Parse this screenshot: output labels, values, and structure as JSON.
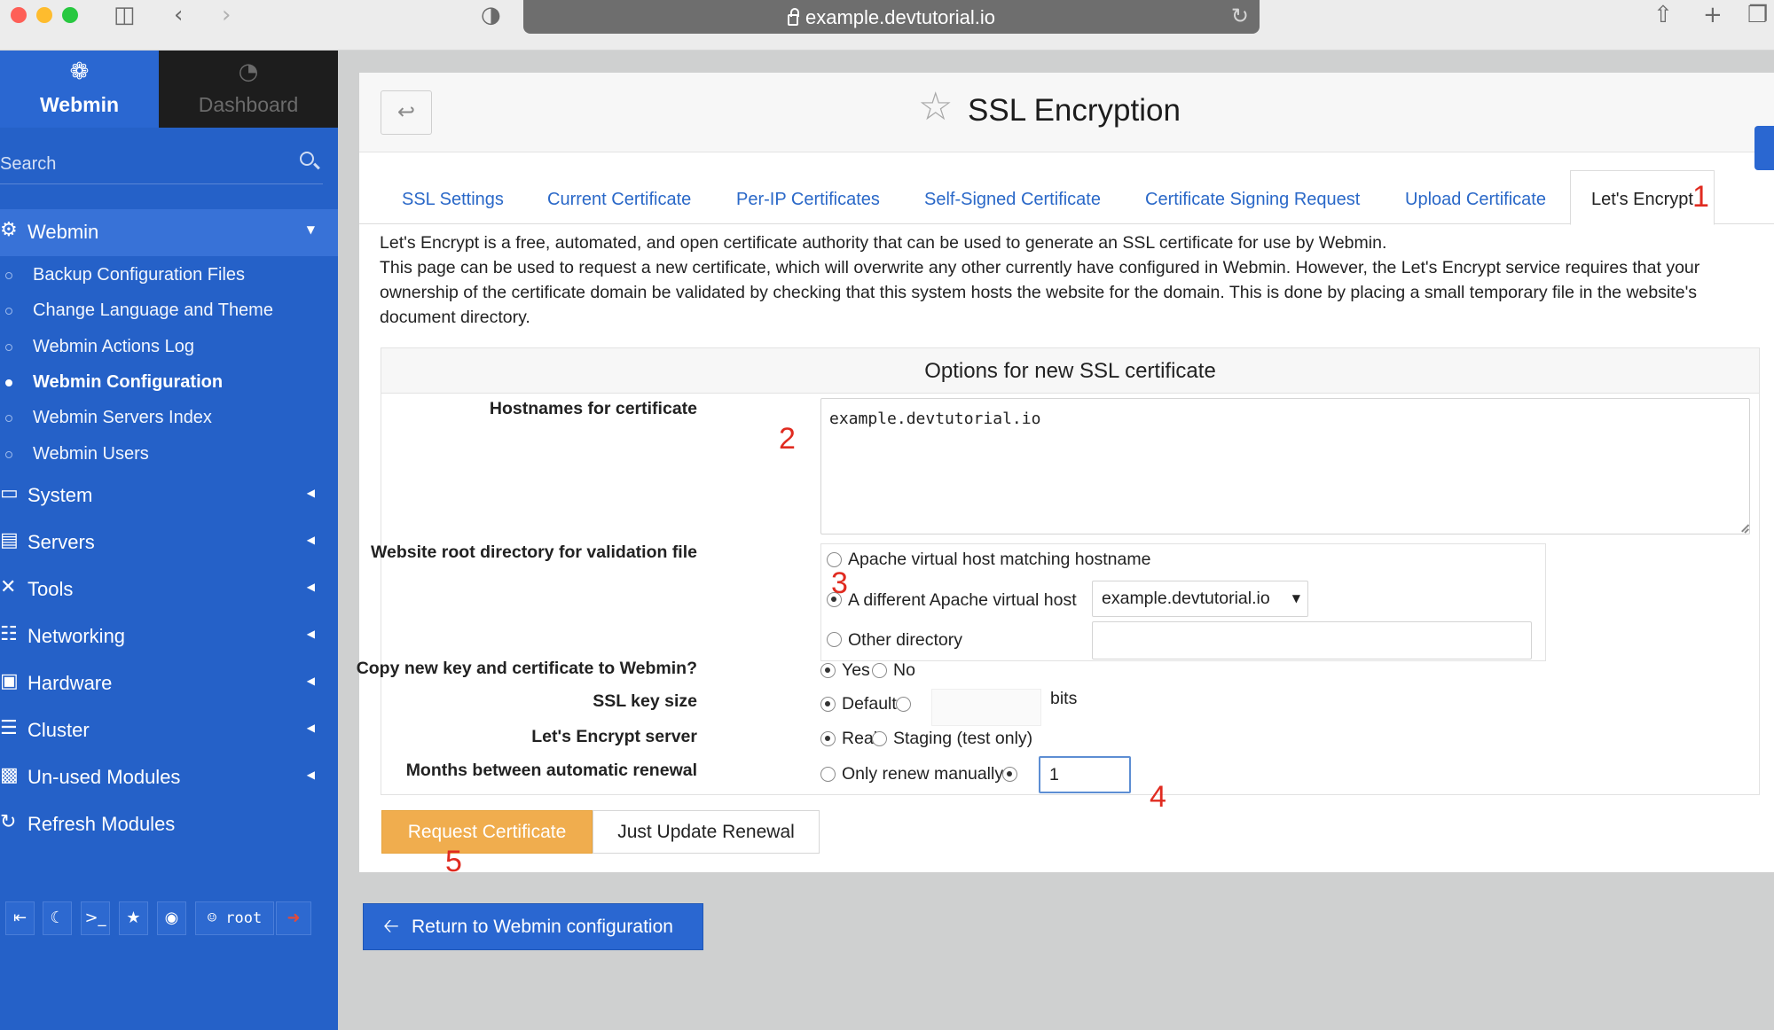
{
  "browser": {
    "url": "example.devtutorial.io"
  },
  "sidebar": {
    "brand": "Webmin",
    "dashboard": "Dashboard",
    "search_placeholder": "Search",
    "webmin_category": "Webmin",
    "webmin_items": [
      "Backup Configuration Files",
      "Change Language and Theme",
      "Webmin Actions Log",
      "Webmin Configuration",
      "Webmin Servers Index",
      "Webmin Users"
    ],
    "active_item": "Webmin Configuration",
    "categories": [
      "System",
      "Servers",
      "Tools",
      "Networking",
      "Hardware",
      "Cluster",
      "Un-used Modules",
      "Refresh Modules"
    ],
    "footer_user": "root"
  },
  "page": {
    "title": "SSL Encryption",
    "tabs": [
      "SSL Settings",
      "Current Certificate",
      "Per-IP Certificates",
      "Self-Signed Certificate",
      "Certificate Signing Request",
      "Upload Certificate",
      "Let's Encrypt"
    ],
    "active_tab": "Let's Encrypt",
    "intro_line1": "Let's Encrypt is a free, automated, and open certificate authority that can be used to generate an SSL certificate for use by Webmin.",
    "intro_line2": "This page can be used to request a new certificate, which will overwrite any other currently have configured in Webmin. However, the Let's Encrypt service requires that your ownership of the certificate domain be validated by checking that this system hosts the website for the domain. This is done by placing a small temporary file in the website's document directory."
  },
  "form": {
    "title": "Options for new SSL certificate",
    "hostnames_label": "Hostnames for certificate",
    "hostnames_value": "example.devtutorial.io",
    "webroot_label": "Website root directory for validation file",
    "webroot_opt1": "Apache virtual host matching hostname",
    "webroot_opt2": "A different Apache virtual host",
    "webroot_opt3": "Other directory",
    "vhost_selected": "example.devtutorial.io",
    "copy_label": "Copy new key and certificate to Webmin?",
    "copy_yes": "Yes",
    "copy_no": "No",
    "keysize_label": "SSL key size",
    "keysize_default": "Default",
    "keysize_unit": "bits",
    "server_label": "Let's Encrypt server",
    "server_real": "Real",
    "server_staging": "Staging (test only)",
    "months_label": "Months between automatic renewal",
    "months_manual": "Only renew manually",
    "months_value": "1"
  },
  "buttons": {
    "request": "Request Certificate",
    "update": "Just Update Renewal",
    "return": "Return to Webmin configuration"
  },
  "annotations": [
    "1",
    "2",
    "3",
    "4",
    "5"
  ],
  "colors": {
    "sidebar": "#2561c8",
    "accent_link": "#2a68c8",
    "request_button": "#f0ad4e",
    "annotation": "#e02b20"
  }
}
